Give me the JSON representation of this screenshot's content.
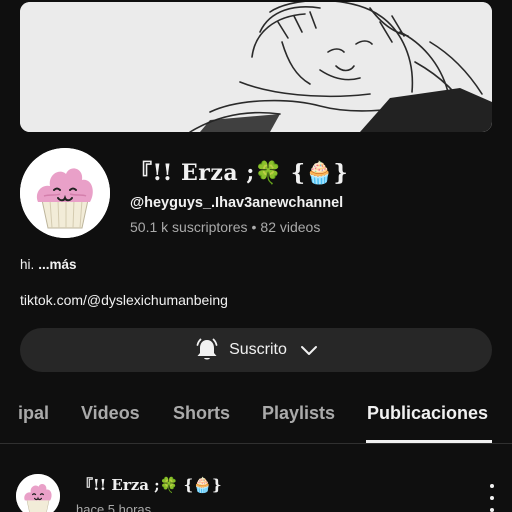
{
  "channel": {
    "name": "『!! Erza ;🍀 {🧁}",
    "handle": "@heyguys_.Ihav3anewchannel",
    "subscribers": "50.1 k suscriptores",
    "separator": "•",
    "videos": "82 videos",
    "description": "hi.",
    "more_label": "...más",
    "link": "tiktok.com/@dyslexichumanbeing"
  },
  "subscribe": {
    "label": "Suscrito",
    "bell_icon": "bell-icon",
    "chevron_icon": "chevron-down-icon"
  },
  "tabs": [
    {
      "label": "ipal",
      "active": false
    },
    {
      "label": "Videos",
      "active": false
    },
    {
      "label": "Shorts",
      "active": false
    },
    {
      "label": "Playlists",
      "active": false
    },
    {
      "label": "Publicaciones",
      "active": true
    }
  ],
  "post": {
    "author": "『!! Erza ;🍀 {🧁}",
    "time": "hace 5 horas"
  },
  "colors": {
    "background": "#0f0f0f",
    "button": "#272727",
    "text": "#f1f1f1",
    "muted": "#aaaaaa",
    "cupcake_frosting": "#e9a0c8"
  }
}
